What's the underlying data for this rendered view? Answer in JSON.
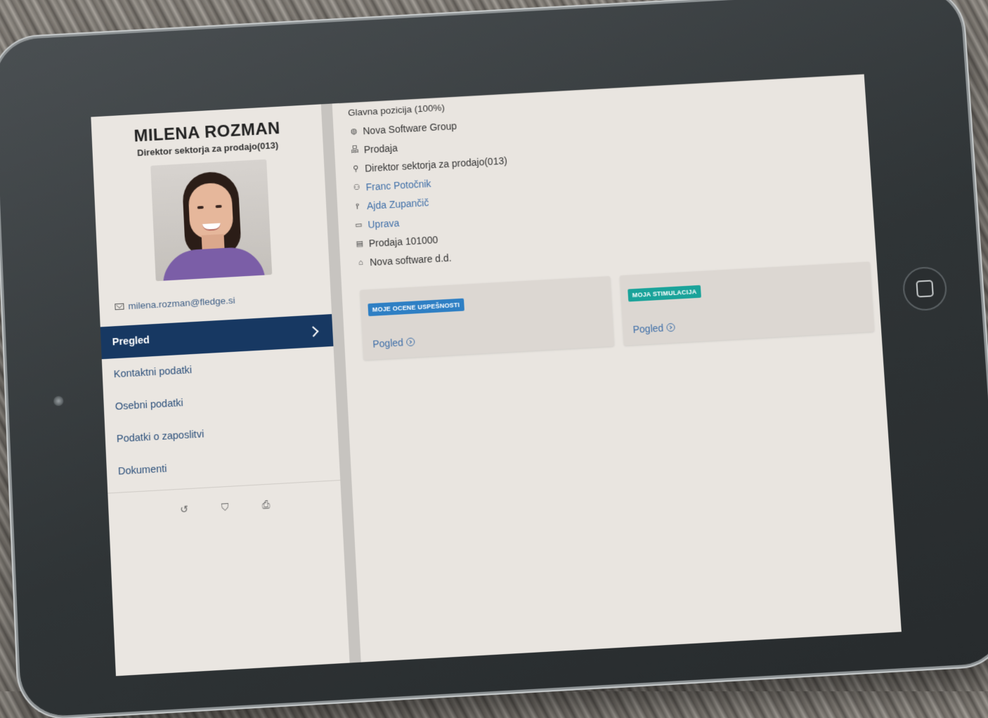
{
  "profile": {
    "name": "MILENA ROZMAN",
    "role": "Direktor sektorja za prodajo(013)",
    "email": "milena.rozman@fledge.si"
  },
  "nav": {
    "items": [
      {
        "label": "Pregled",
        "active": true
      },
      {
        "label": "Kontaktni podatki",
        "active": false
      },
      {
        "label": "Osebni podatki",
        "active": false
      },
      {
        "label": "Podatki o zaposlitvi",
        "active": false
      },
      {
        "label": "Dokumenti",
        "active": false
      }
    ]
  },
  "footer_icons": [
    "history-icon",
    "shield-icon",
    "print-icon"
  ],
  "position": {
    "title": "Glavna pozicija (100%)",
    "rows": [
      {
        "icon": "globe-icon",
        "text": "Nova Software Group",
        "link": false
      },
      {
        "icon": "org-chart-icon",
        "text": "Prodaja",
        "link": false
      },
      {
        "icon": "user-role-icon",
        "text": "Direktor sektorja za prodajo(013)",
        "link": false
      },
      {
        "icon": "manager-icon",
        "text": "Franc Potočnik",
        "link": true
      },
      {
        "icon": "hierarchy-icon",
        "text": "Ajda Zupančič",
        "link": true
      },
      {
        "icon": "briefcase-icon",
        "text": "Uprava",
        "link": true
      },
      {
        "icon": "money-icon",
        "text": "Prodaja 101000",
        "link": false
      },
      {
        "icon": "building-icon",
        "text": "Nova software d.d.",
        "link": false
      }
    ]
  },
  "cards": [
    {
      "badge": "MOJE OCENE USPEŠNOSTI",
      "link": "Pogled",
      "color": "#2e7fc4"
    },
    {
      "badge": "MOJA STIMULACIJA",
      "link": "Pogled",
      "color": "#1aa39a"
    }
  ]
}
